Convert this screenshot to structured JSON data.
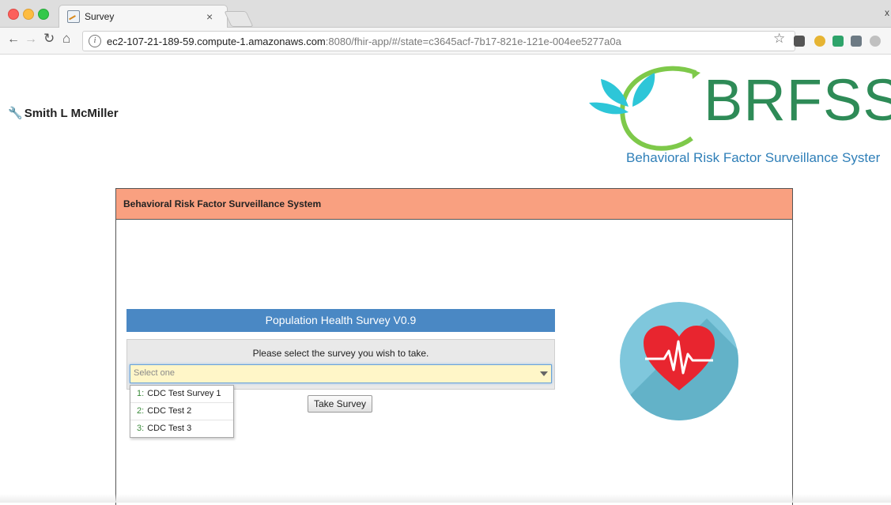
{
  "browser": {
    "tab_title": "Survey",
    "tab_close": "×",
    "window_close": "x",
    "url_host": "ec2-107-21-189-59.compute-1.amazonaws.com",
    "url_rest": ":8080/fhir-app/#/state=c3645acf-7b17-821e-121e-004ee5277a0a"
  },
  "header": {
    "user_name": "Smith L McMiller",
    "logo_text": "BRFSS",
    "logo_subtitle": "Behavioral Risk Factor Surveillance Syster"
  },
  "panel": {
    "title": "Behavioral Risk Factor Surveillance System"
  },
  "survey": {
    "heading": "Population Health Survey V0.9",
    "prompt": "Please select the survey you wish to take.",
    "select_placeholder": "Select one",
    "options": [
      {
        "num": "1:",
        "label": "CDC Test Survey 1"
      },
      {
        "num": "2:",
        "label": "CDC Test 2"
      },
      {
        "num": "3:",
        "label": "CDC Test 3"
      }
    ],
    "button_label": "Take Survey"
  },
  "colors": {
    "panel_header": "#f9a080",
    "survey_header": "#4a88c4",
    "select_bg": "#fff6c8",
    "logo_green": "#2e8b57",
    "logo_blue": "#2f7fb8",
    "heart_red": "#e8252f",
    "circle": "#7fc7dc"
  }
}
